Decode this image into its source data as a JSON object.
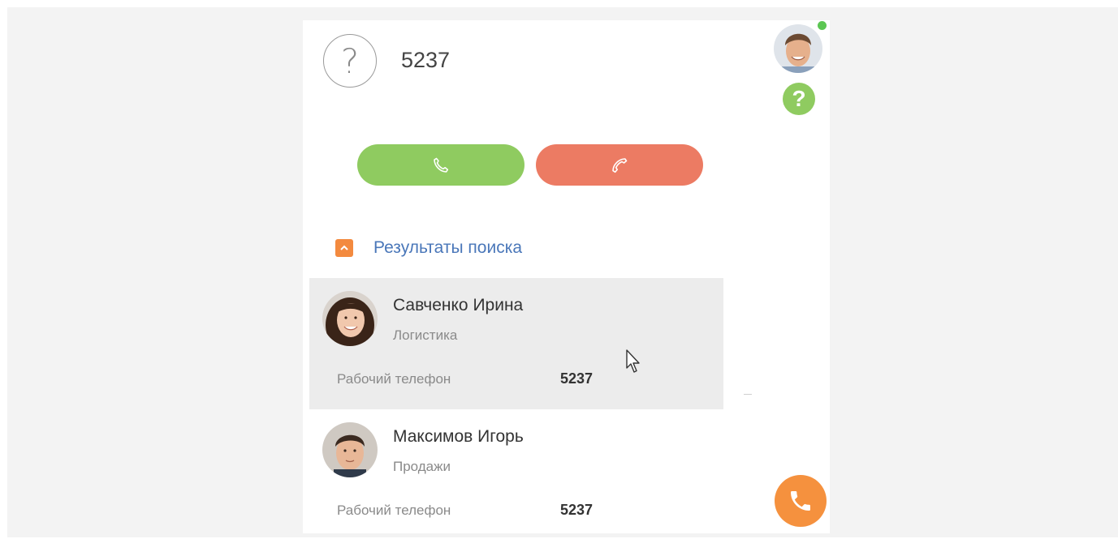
{
  "caller": {
    "icon": "question-mark-icon",
    "number": "5237"
  },
  "call_buttons": {
    "answer_icon": "phone-icon",
    "hangup_icon": "phone-hangup-icon",
    "answer_color": "#8fcb60",
    "hangup_color": "#ec7b63"
  },
  "results": {
    "collapse_icon": "chevron-up-icon",
    "title": "Результаты поиска",
    "contacts": [
      {
        "name": "Савченко Ирина",
        "department": "Логистика",
        "phone_label": "Рабочий телефон",
        "phone": "5237",
        "avatar": "avatar-female"
      },
      {
        "name": "Максимов Игорь",
        "department": "Продажи",
        "phone_label": "Рабочий телефон",
        "phone": "5237",
        "avatar": "avatar-male"
      }
    ]
  },
  "sidebar": {
    "user_avatar": "user-avatar",
    "status": "online",
    "status_color": "#5cc653",
    "help_icon": "question-mark-icon",
    "help_label": "?",
    "phone_icon": "phone-icon",
    "accent_color": "#f5913e"
  }
}
